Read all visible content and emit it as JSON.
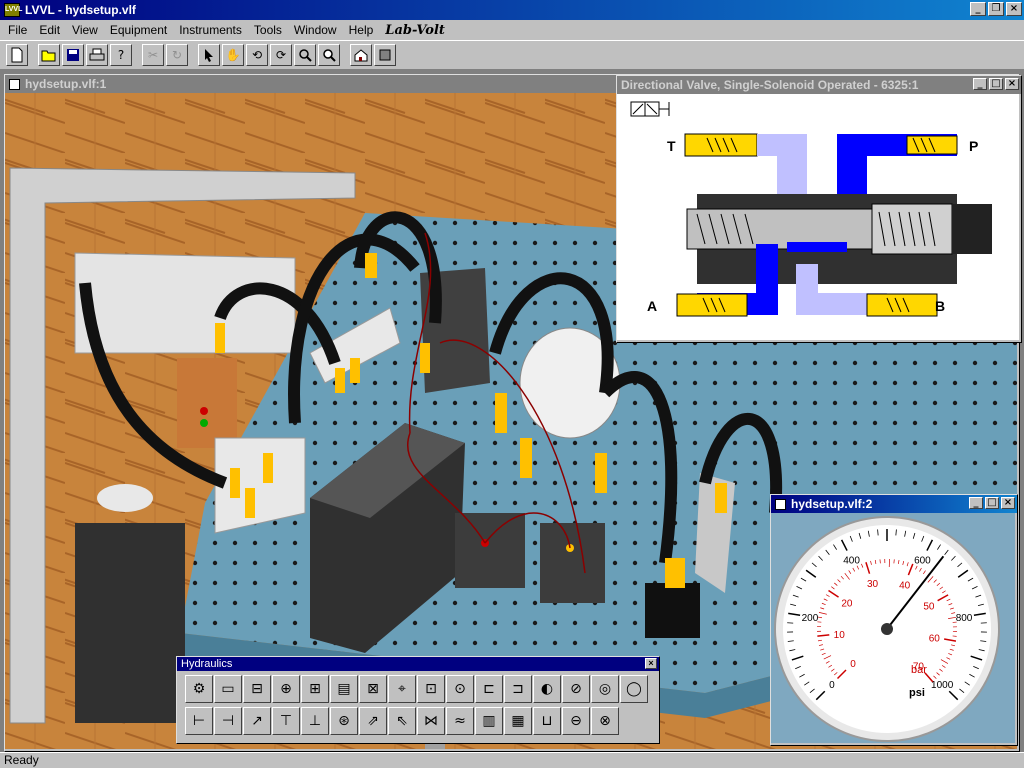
{
  "app": {
    "title": "LVVL - hydsetup.vlf",
    "logo_icon_text": "LVVL"
  },
  "menu": {
    "items": [
      "File",
      "Edit",
      "View",
      "Equipment",
      "Instruments",
      "Tools",
      "Window",
      "Help"
    ],
    "logo": "Lab-Volt"
  },
  "toolbar": {
    "buttons": [
      "new-icon",
      "open-icon",
      "save-icon",
      "print-icon",
      "help-icon",
      "cut-icon",
      "redo-icon",
      "pointer-icon",
      "hand-icon",
      "rotate-icon",
      "turn-icon",
      "zoom-icon",
      "zoom-fit-icon",
      "home-icon",
      "book-icon"
    ]
  },
  "windows": {
    "scene": {
      "title": "hydsetup.vlf:1"
    },
    "valve": {
      "title": "Directional Valve, Single-Solenoid Operated - 6325:1",
      "ports": {
        "t": "T",
        "p": "P",
        "a": "A",
        "b": "B"
      }
    },
    "gauge": {
      "title": "hydsetup.vlf:2",
      "psi_ticks": [
        "0",
        "200",
        "400",
        "600",
        "800",
        "1000"
      ],
      "bar_ticks": [
        "0",
        "10",
        "20",
        "30",
        "40",
        "50",
        "60",
        "70"
      ],
      "unit_bar": "bar",
      "unit_psi": "psi",
      "needle_psi": 640
    }
  },
  "palette": {
    "title": "Hydraulics",
    "row1_count": 16,
    "row2_count": 15
  },
  "status": {
    "text": "Ready"
  },
  "colors": {
    "titlebar_active": "#000080",
    "desktop": "#c0c0c0",
    "hydraulic_blue": "#0000ff",
    "hydraulic_light": "#b8b8ff",
    "fitting_yellow": "#ffc000"
  }
}
